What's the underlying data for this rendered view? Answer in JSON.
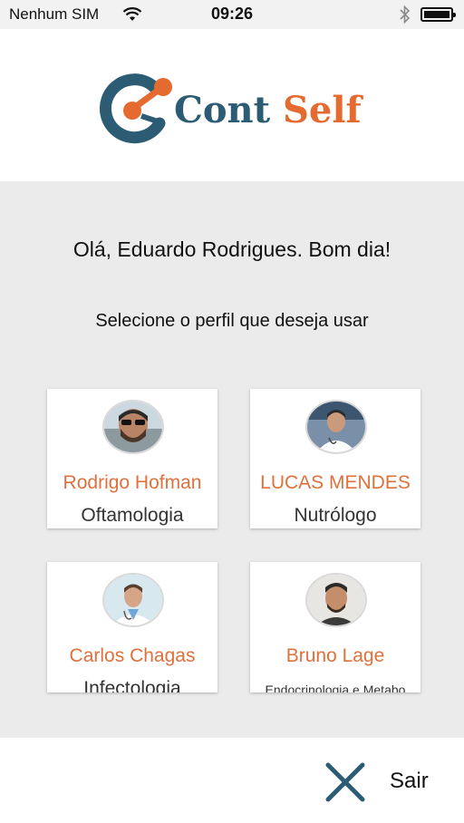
{
  "status_bar": {
    "carrier": "Nenhum SIM",
    "time": "09:26",
    "icons": [
      "wifi-icon",
      "bluetooth-icon",
      "battery-icon"
    ]
  },
  "header": {
    "logo_text_primary": "Cont",
    "logo_text_secondary": "Self",
    "brand_colors": {
      "primary": "#2b5c74",
      "accent": "#e46a30"
    }
  },
  "main": {
    "greeting": "Olá, Eduardo Rodrigues. Bom dia!",
    "instruction": "Selecione o perfil que deseja usar",
    "profiles": [
      {
        "name": "Rodrigo Hofman",
        "specialty": "Oftamologia"
      },
      {
        "name": "LUCAS MENDES",
        "specialty": "Nutrólogo"
      },
      {
        "name": "Carlos Chagas",
        "specialty": "Infectologia"
      },
      {
        "name": "Bruno Lage",
        "specialty": "Endocrinologia e Metabo"
      }
    ]
  },
  "footer": {
    "exit_label": "Sair",
    "exit_icon": "close-icon"
  }
}
